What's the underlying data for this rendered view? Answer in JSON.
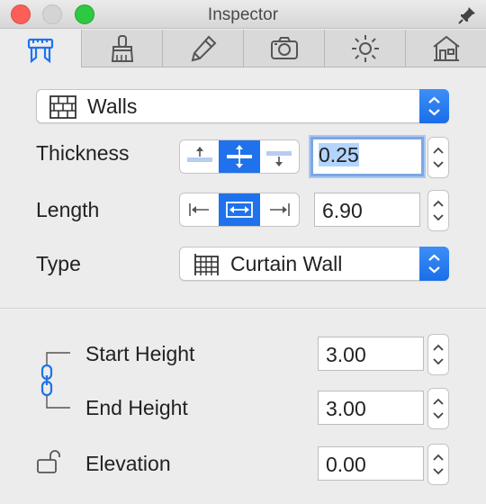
{
  "window": {
    "title": "Inspector"
  },
  "tabs": [
    {
      "name": "measure"
    },
    {
      "name": "brush"
    },
    {
      "name": "pencil"
    },
    {
      "name": "camera"
    },
    {
      "name": "sun"
    },
    {
      "name": "house"
    }
  ],
  "element_type": {
    "label": "Walls"
  },
  "thickness": {
    "label": "Thickness",
    "value": "0.25",
    "selected_alignment": "center"
  },
  "length": {
    "label": "Length",
    "value": "6.90",
    "selected_alignment": "center"
  },
  "type": {
    "label": "Type",
    "value": "Curtain Wall"
  },
  "start_height": {
    "label": "Start Height",
    "value": "3.00"
  },
  "end_height": {
    "label": "End Height",
    "value": "3.00"
  },
  "elevation": {
    "label": "Elevation",
    "value": "0.00"
  },
  "colors": {
    "accent": "#1f72ec",
    "close": "#fc5f57",
    "zoom": "#2ec843"
  }
}
